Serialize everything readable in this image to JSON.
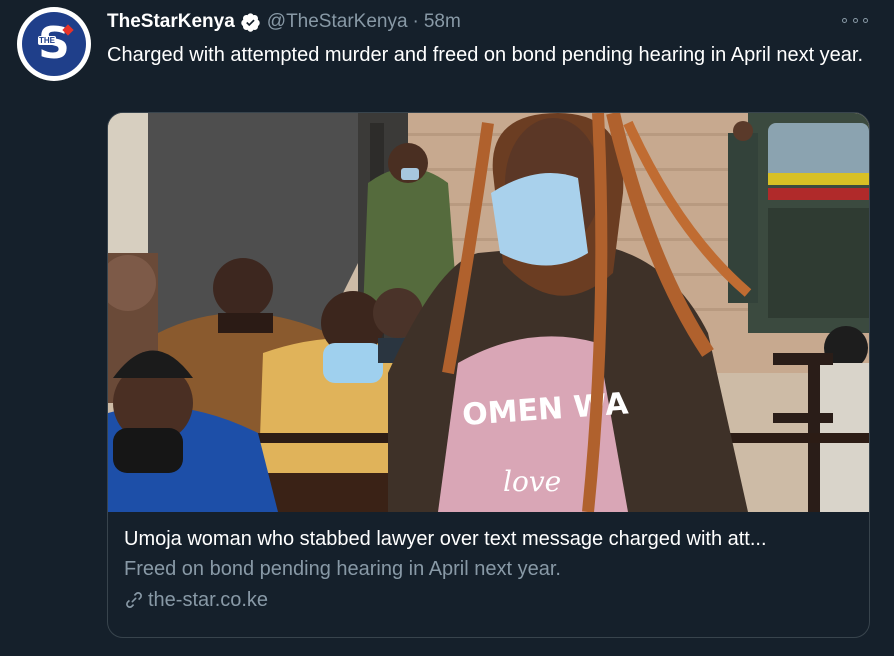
{
  "tweet": {
    "display_name": "TheStarKenya",
    "handle": "@TheStarKenya",
    "separator": "·",
    "time": "58m",
    "text": "Charged with attempted murder and freed on bond pending hearing in April next year.",
    "verified": true
  },
  "avatar": {
    "letter": "S",
    "small_text": "THE"
  },
  "card": {
    "title": "Umoja woman who stabbed lawyer over text message charged with att...",
    "description": "Freed on bond pending hearing in April next year.",
    "domain": "the-star.co.ke",
    "image_shirt_text": "OMEN WA",
    "image_shirt_text2": "love"
  },
  "colors": {
    "background": "#15202b",
    "secondary_text": "#8899a6",
    "border": "#38444d",
    "verified": "#ffffff",
    "avatar_blue": "#1f3f8a"
  }
}
